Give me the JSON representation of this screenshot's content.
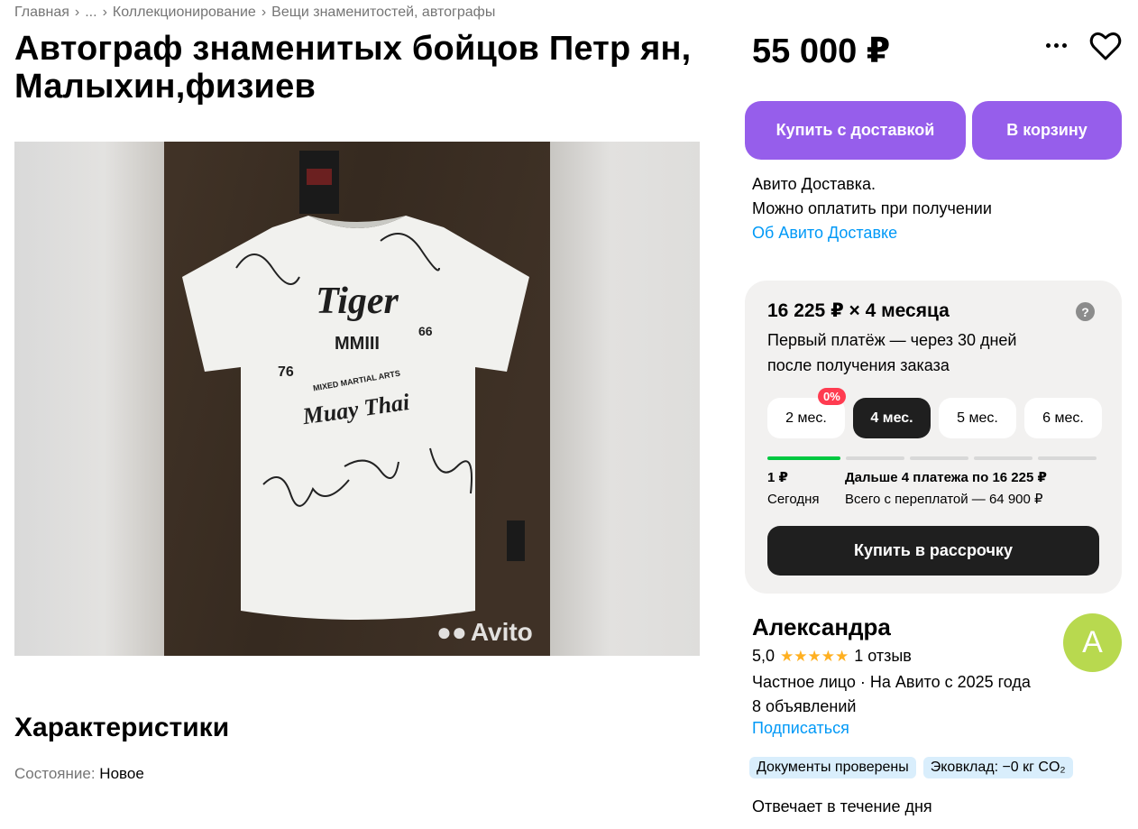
{
  "breadcrumb": {
    "home": "Главная",
    "ellipsis": "...",
    "cat1": "Коллекционирование",
    "cat2": "Вещи знаменитостей, автографы"
  },
  "title": "Автограф знаменитых бойцов Петр ян, Малыхин,физиев",
  "gallery": {
    "watermark": "Avito"
  },
  "specs": {
    "heading": "Характеристики",
    "condition_label": "Состояние:",
    "condition_value": "Новое"
  },
  "price": "55 000 ₽",
  "buttons": {
    "buy_delivery": "Купить с доставкой",
    "cart": "В корзину"
  },
  "delivery": {
    "line1": "Авито Доставка.",
    "line2": "Можно оплатить при получении",
    "link": "Об Авито Доставке"
  },
  "installment": {
    "headline": "16 225 ₽ × 4 месяца",
    "help": "?",
    "subtitle": "Первый платёж — через 30 дней после получения заказа",
    "badge": "0%",
    "months": [
      "2 мес.",
      "4 мес.",
      "5 мес.",
      "6 мес."
    ],
    "selected": "4 мес.",
    "first_amount": "1 ₽",
    "first_when": "Сегодня",
    "rest": "Дальше 4 платежа по 16 225 ₽",
    "total": "Всего с переплатой — 64 900 ₽",
    "button": "Купить в рассрочку"
  },
  "seller": {
    "name": "Александра",
    "avatar_letter": "А",
    "rating": "5,0",
    "stars": "★★★★★",
    "reviews": "1 отзыв",
    "info": "Частное лицо · На Авито с 2025 года",
    "ads": "8 объявлений",
    "subscribe": "Подписаться",
    "tags": [
      "Документы проверены",
      "Эковклад: −0 кг CO₂"
    ],
    "reply": "Отвечает в течение дня"
  },
  "colors": {
    "accent": "#965eeb",
    "link": "#0099f7",
    "star": "#ffb021",
    "avatar": "#b8d94f"
  }
}
